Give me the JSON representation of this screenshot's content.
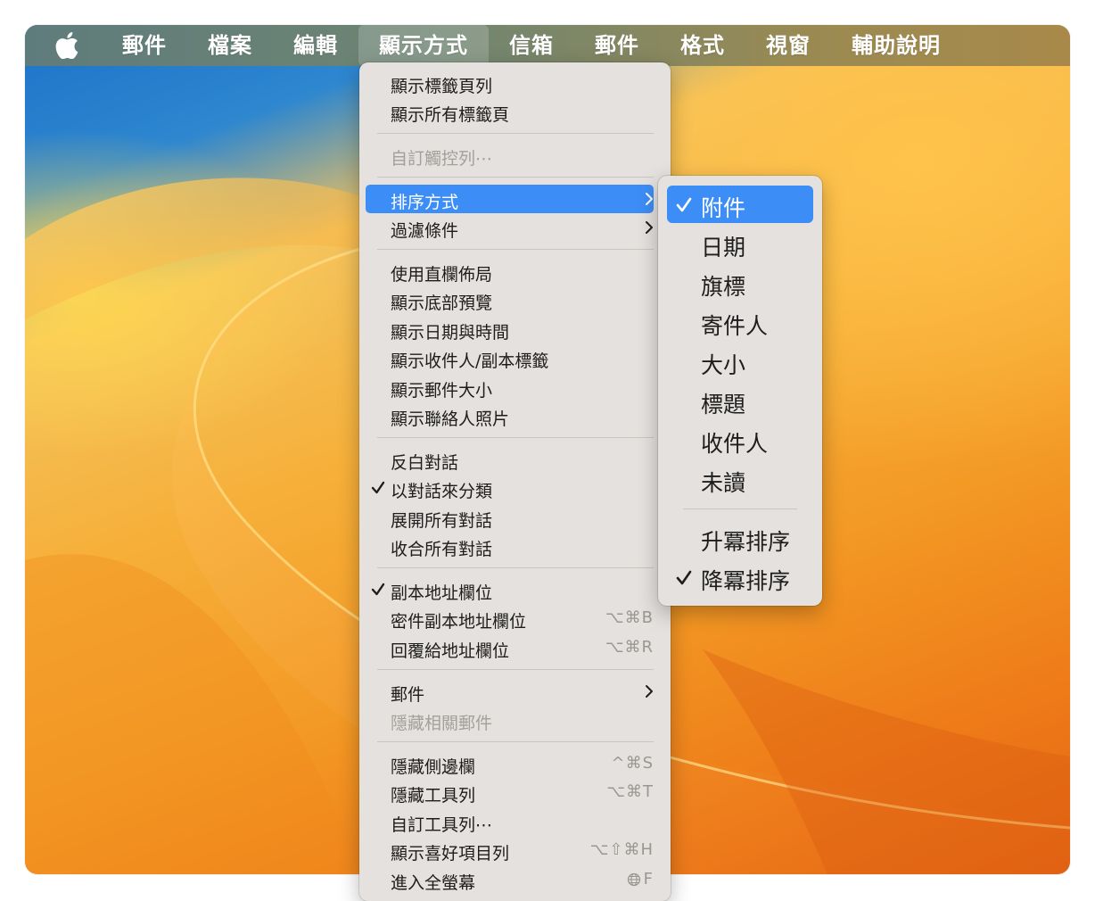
{
  "menubar": {
    "apple_icon": "apple-logo-icon",
    "items": [
      "郵件",
      "檔案",
      "編輯",
      "顯示方式",
      "信箱",
      "郵件",
      "格式",
      "視窗",
      "輔助說明"
    ],
    "active_index": 3
  },
  "view_menu": {
    "items": [
      {
        "label": "顯示標籤頁列"
      },
      {
        "label": "顯示所有標籤頁"
      },
      {
        "label": "自訂觸控列⋯"
      },
      {
        "label": "排序方式"
      },
      {
        "label": "過濾條件"
      },
      {
        "label": "使用直欄佈局"
      },
      {
        "label": "顯示底部預覽"
      },
      {
        "label": "顯示日期與時間"
      },
      {
        "label": "顯示收件人/副本標籤"
      },
      {
        "label": "顯示郵件大小"
      },
      {
        "label": "顯示聯絡人照片"
      },
      {
        "label": "反白對話"
      },
      {
        "label": "以對話來分類"
      },
      {
        "label": "展開所有對話"
      },
      {
        "label": "收合所有對話"
      },
      {
        "label": "副本地址欄位"
      },
      {
        "label": "密件副本地址欄位",
        "shortcut": "⌥⌘B"
      },
      {
        "label": "回覆給地址欄位",
        "shortcut": "⌥⌘R"
      },
      {
        "label": "郵件"
      },
      {
        "label": "隱藏相關郵件"
      },
      {
        "label": "隱藏側邊欄",
        "shortcut": "^⌘S"
      },
      {
        "label": "隱藏工具列",
        "shortcut": "⌥⌘T"
      },
      {
        "label": "自訂工具列⋯"
      },
      {
        "label": "顯示喜好項目列",
        "shortcut": "⌥⇧⌘H"
      },
      {
        "label": "進入全螢幕",
        "shortcut": "F"
      }
    ]
  },
  "sort_submenu": {
    "items": [
      {
        "label": "附件"
      },
      {
        "label": "日期"
      },
      {
        "label": "旗標"
      },
      {
        "label": "寄件人"
      },
      {
        "label": "大小"
      },
      {
        "label": "標題"
      },
      {
        "label": "收件人"
      },
      {
        "label": "未讀"
      },
      {
        "label": "升冪排序"
      },
      {
        "label": "降冪排序"
      }
    ]
  },
  "colors": {
    "highlight": "#3d8df7",
    "menu_bg": "#e5e1de",
    "disabled_text": "#a3a09c",
    "shortcut_text": "#9a9692"
  }
}
